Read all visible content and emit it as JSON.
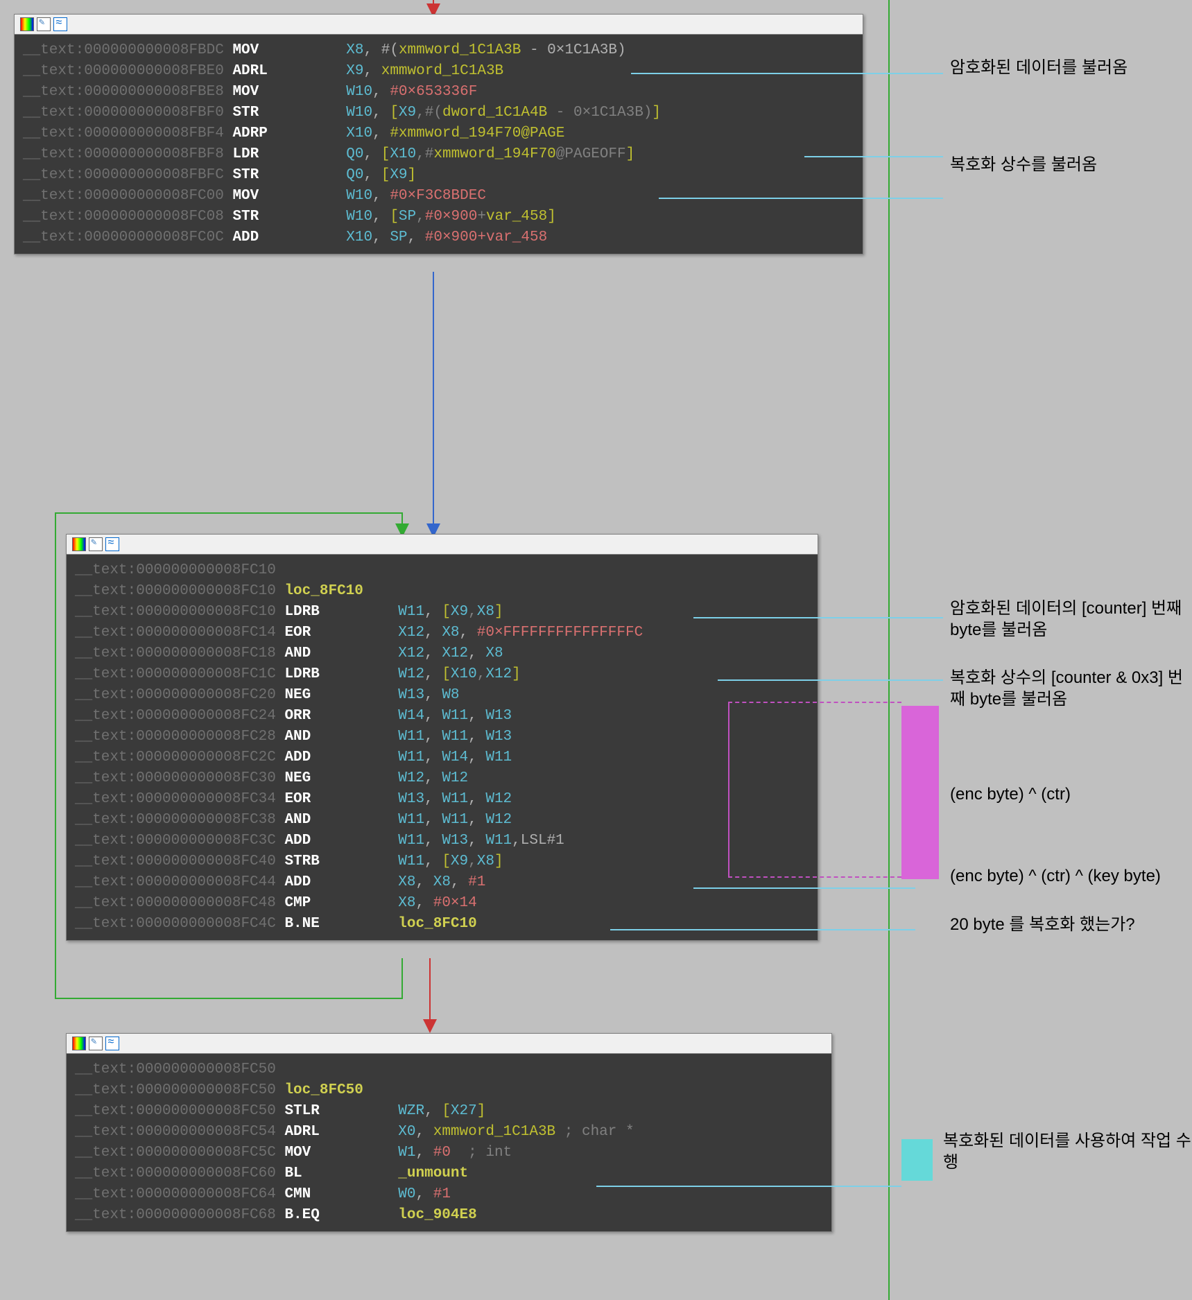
{
  "block1": {
    "lines": [
      {
        "addr": "__text:000000000008FBDC",
        "mn": "MOV",
        "ops": [
          {
            "t": "reg",
            "v": "X8"
          },
          {
            "t": "imm",
            "il": "#(",
            "sym": "xmmword_1C1A3B",
            "tail": " - 0×1C1A3B)"
          }
        ]
      },
      {
        "addr": "__text:000000000008FBE0",
        "mn": "ADRL",
        "ops": [
          {
            "t": "reg",
            "v": "X9"
          },
          {
            "t": "sym",
            "v": "xmmword_1C1A3B"
          }
        ]
      },
      {
        "addr": "__text:000000000008FBE8",
        "mn": "MOV",
        "ops": [
          {
            "t": "reg",
            "v": "W10"
          },
          {
            "t": "hex",
            "v": "#0×653336F"
          }
        ]
      },
      {
        "addr": "__text:000000000008FBF0",
        "mn": "STR",
        "ops": [
          {
            "t": "reg",
            "v": "W10"
          },
          {
            "t": "mem",
            "v": "[X9,#(dword_1C1A4B - 0×1C1A3B)]"
          }
        ]
      },
      {
        "addr": "__text:000000000008FBF4",
        "mn": "ADRP",
        "ops": [
          {
            "t": "reg",
            "v": "X10"
          },
          {
            "t": "sym",
            "v": "#xmmword_194F70@PAGE"
          }
        ]
      },
      {
        "addr": "__text:000000000008FBF8",
        "mn": "LDR",
        "ops": [
          {
            "t": "reg",
            "v": "Q0"
          },
          {
            "t": "mem",
            "v": "[X10,#xmmword_194F70@PAGEOFF]"
          }
        ]
      },
      {
        "addr": "__text:000000000008FBFC",
        "mn": "STR",
        "ops": [
          {
            "t": "reg",
            "v": "Q0"
          },
          {
            "t": "mem",
            "v": "[X9]"
          }
        ]
      },
      {
        "addr": "__text:000000000008FC00",
        "mn": "MOV",
        "ops": [
          {
            "t": "reg",
            "v": "W10"
          },
          {
            "t": "hex",
            "v": "#0×F3C8BDEC"
          }
        ]
      },
      {
        "addr": "__text:000000000008FC08",
        "mn": "STR",
        "ops": [
          {
            "t": "reg",
            "v": "W10"
          },
          {
            "t": "mem",
            "v": "[SP,#0×900+var_458]"
          }
        ]
      },
      {
        "addr": "__text:000000000008FC0C",
        "mn": "ADD",
        "ops": [
          {
            "t": "reg",
            "v": "X10"
          },
          {
            "t": "reg",
            "v": "SP"
          },
          {
            "t": "hex",
            "v": "#0×900+var_458"
          }
        ]
      }
    ]
  },
  "block2": {
    "label": "loc_8FC10",
    "lines": [
      {
        "addr": "__text:000000000008FC10",
        "mn": "",
        "ops": []
      },
      {
        "addr": "__text:000000000008FC10",
        "mn": "",
        "label": "loc_8FC10"
      },
      {
        "addr": "__text:000000000008FC10",
        "mn": "LDRB",
        "ops": [
          {
            "t": "reg",
            "v": "W11"
          },
          {
            "t": "mem",
            "v": "[X9,X8]"
          }
        ]
      },
      {
        "addr": "__text:000000000008FC14",
        "mn": "EOR",
        "ops": [
          {
            "t": "reg",
            "v": "X12"
          },
          {
            "t": "reg",
            "v": "X8"
          },
          {
            "t": "hex",
            "v": "#0×FFFFFFFFFFFFFFFC"
          }
        ]
      },
      {
        "addr": "__text:000000000008FC18",
        "mn": "AND",
        "ops": [
          {
            "t": "reg",
            "v": "X12"
          },
          {
            "t": "reg",
            "v": "X12"
          },
          {
            "t": "reg",
            "v": "X8"
          }
        ]
      },
      {
        "addr": "__text:000000000008FC1C",
        "mn": "LDRB",
        "ops": [
          {
            "t": "reg",
            "v": "W12"
          },
          {
            "t": "mem",
            "v": "[X10,X12]"
          }
        ]
      },
      {
        "addr": "__text:000000000008FC20",
        "mn": "NEG",
        "ops": [
          {
            "t": "reg",
            "v": "W13"
          },
          {
            "t": "reg",
            "v": "W8"
          }
        ]
      },
      {
        "addr": "__text:000000000008FC24",
        "mn": "ORR",
        "ops": [
          {
            "t": "reg",
            "v": "W14"
          },
          {
            "t": "reg",
            "v": "W11"
          },
          {
            "t": "reg",
            "v": "W13"
          }
        ]
      },
      {
        "addr": "__text:000000000008FC28",
        "mn": "AND",
        "ops": [
          {
            "t": "reg",
            "v": "W11"
          },
          {
            "t": "reg",
            "v": "W11"
          },
          {
            "t": "reg",
            "v": "W13"
          }
        ]
      },
      {
        "addr": "__text:000000000008FC2C",
        "mn": "ADD",
        "ops": [
          {
            "t": "reg",
            "v": "W11"
          },
          {
            "t": "reg",
            "v": "W14"
          },
          {
            "t": "reg",
            "v": "W11"
          }
        ]
      },
      {
        "addr": "__text:000000000008FC30",
        "mn": "NEG",
        "ops": [
          {
            "t": "reg",
            "v": "W12"
          },
          {
            "t": "reg",
            "v": "W12"
          }
        ]
      },
      {
        "addr": "__text:000000000008FC34",
        "mn": "EOR",
        "ops": [
          {
            "t": "reg",
            "v": "W13"
          },
          {
            "t": "reg",
            "v": "W11"
          },
          {
            "t": "reg",
            "v": "W12"
          }
        ]
      },
      {
        "addr": "__text:000000000008FC38",
        "mn": "AND",
        "ops": [
          {
            "t": "reg",
            "v": "W11"
          },
          {
            "t": "reg",
            "v": "W11"
          },
          {
            "t": "reg",
            "v": "W12"
          }
        ]
      },
      {
        "addr": "__text:000000000008FC3C",
        "mn": "ADD",
        "ops": [
          {
            "t": "reg",
            "v": "W11"
          },
          {
            "t": "reg",
            "v": "W13"
          },
          {
            "t": "reg",
            "v": "W11"
          },
          {
            "t": "plain",
            "v": ",LSL#1"
          }
        ]
      },
      {
        "addr": "__text:000000000008FC40",
        "mn": "STRB",
        "ops": [
          {
            "t": "reg",
            "v": "W11"
          },
          {
            "t": "mem",
            "v": "[X9,X8]"
          }
        ]
      },
      {
        "addr": "__text:000000000008FC44",
        "mn": "ADD",
        "ops": [
          {
            "t": "reg",
            "v": "X8"
          },
          {
            "t": "reg",
            "v": "X8"
          },
          {
            "t": "hex",
            "v": "#1"
          }
        ]
      },
      {
        "addr": "__text:000000000008FC48",
        "mn": "CMP",
        "ops": [
          {
            "t": "reg",
            "v": "X8"
          },
          {
            "t": "hex",
            "v": "#0×14"
          }
        ]
      },
      {
        "addr": "__text:000000000008FC4C",
        "mn": "B.NE",
        "ops": [
          {
            "t": "label",
            "v": "loc_8FC10"
          }
        ]
      }
    ]
  },
  "block3": {
    "label": "loc_8FC50",
    "lines": [
      {
        "addr": "__text:000000000008FC50",
        "mn": "",
        "ops": []
      },
      {
        "addr": "__text:000000000008FC50",
        "mn": "",
        "label": "loc_8FC50"
      },
      {
        "addr": "__text:000000000008FC50",
        "mn": "STLR",
        "ops": [
          {
            "t": "reg",
            "v": "WZR"
          },
          {
            "t": "mem",
            "v": "[X27]"
          }
        ]
      },
      {
        "addr": "__text:000000000008FC54",
        "mn": "ADRL",
        "ops": [
          {
            "t": "reg",
            "v": "X0"
          },
          {
            "t": "sym",
            "v": "xmmword_1C1A3B"
          },
          {
            "t": "comment",
            "v": " ; char *"
          }
        ]
      },
      {
        "addr": "__text:000000000008FC5C",
        "mn": "MOV",
        "ops": [
          {
            "t": "reg",
            "v": "W1"
          },
          {
            "t": "hex",
            "v": "#0"
          },
          {
            "t": "comment",
            "v": "  ; int"
          }
        ]
      },
      {
        "addr": "__text:000000000008FC60",
        "mn": "BL",
        "ops": [
          {
            "t": "label",
            "v": "_unmount"
          }
        ]
      },
      {
        "addr": "__text:000000000008FC64",
        "mn": "CMN",
        "ops": [
          {
            "t": "reg",
            "v": "W0"
          },
          {
            "t": "hex",
            "v": "#1"
          }
        ]
      },
      {
        "addr": "__text:000000000008FC68",
        "mn": "B.EQ",
        "ops": [
          {
            "t": "label",
            "v": "loc_904E8"
          }
        ]
      }
    ]
  },
  "annotations": {
    "a1": "암호화된 데이터를\n불러옴",
    "a2": "복호화 상수를\n불러옴",
    "a3": "암호화된 데이터의\n[counter] 번째\nbyte를 불러옴",
    "a4": "복호화 상수의\n[counter & 0x3]\n번째 byte를 불러옴",
    "a5": "(enc byte) ^ (ctr)",
    "a6": "(enc byte) ^ (ctr)\n^ (key byte)",
    "a7": "20 byte 를 복호화\n했는가?",
    "a8": "복호화된 데이터를\n사용하여 작업 수행"
  }
}
